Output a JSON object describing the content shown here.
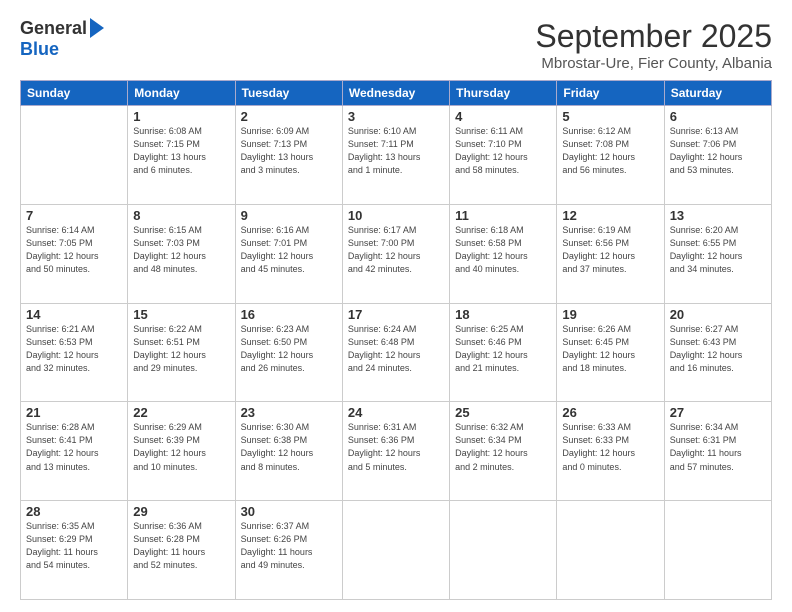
{
  "logo": {
    "general": "General",
    "blue": "Blue"
  },
  "header": {
    "month": "September 2025",
    "location": "Mbrostar-Ure, Fier County, Albania"
  },
  "days_of_week": [
    "Sunday",
    "Monday",
    "Tuesday",
    "Wednesday",
    "Thursday",
    "Friday",
    "Saturday"
  ],
  "weeks": [
    [
      {
        "day": "",
        "info": ""
      },
      {
        "day": "1",
        "info": "Sunrise: 6:08 AM\nSunset: 7:15 PM\nDaylight: 13 hours\nand 6 minutes."
      },
      {
        "day": "2",
        "info": "Sunrise: 6:09 AM\nSunset: 7:13 PM\nDaylight: 13 hours\nand 3 minutes."
      },
      {
        "day": "3",
        "info": "Sunrise: 6:10 AM\nSunset: 7:11 PM\nDaylight: 13 hours\nand 1 minute."
      },
      {
        "day": "4",
        "info": "Sunrise: 6:11 AM\nSunset: 7:10 PM\nDaylight: 12 hours\nand 58 minutes."
      },
      {
        "day": "5",
        "info": "Sunrise: 6:12 AM\nSunset: 7:08 PM\nDaylight: 12 hours\nand 56 minutes."
      },
      {
        "day": "6",
        "info": "Sunrise: 6:13 AM\nSunset: 7:06 PM\nDaylight: 12 hours\nand 53 minutes."
      }
    ],
    [
      {
        "day": "7",
        "info": "Sunrise: 6:14 AM\nSunset: 7:05 PM\nDaylight: 12 hours\nand 50 minutes."
      },
      {
        "day": "8",
        "info": "Sunrise: 6:15 AM\nSunset: 7:03 PM\nDaylight: 12 hours\nand 48 minutes."
      },
      {
        "day": "9",
        "info": "Sunrise: 6:16 AM\nSunset: 7:01 PM\nDaylight: 12 hours\nand 45 minutes."
      },
      {
        "day": "10",
        "info": "Sunrise: 6:17 AM\nSunset: 7:00 PM\nDaylight: 12 hours\nand 42 minutes."
      },
      {
        "day": "11",
        "info": "Sunrise: 6:18 AM\nSunset: 6:58 PM\nDaylight: 12 hours\nand 40 minutes."
      },
      {
        "day": "12",
        "info": "Sunrise: 6:19 AM\nSunset: 6:56 PM\nDaylight: 12 hours\nand 37 minutes."
      },
      {
        "day": "13",
        "info": "Sunrise: 6:20 AM\nSunset: 6:55 PM\nDaylight: 12 hours\nand 34 minutes."
      }
    ],
    [
      {
        "day": "14",
        "info": "Sunrise: 6:21 AM\nSunset: 6:53 PM\nDaylight: 12 hours\nand 32 minutes."
      },
      {
        "day": "15",
        "info": "Sunrise: 6:22 AM\nSunset: 6:51 PM\nDaylight: 12 hours\nand 29 minutes."
      },
      {
        "day": "16",
        "info": "Sunrise: 6:23 AM\nSunset: 6:50 PM\nDaylight: 12 hours\nand 26 minutes."
      },
      {
        "day": "17",
        "info": "Sunrise: 6:24 AM\nSunset: 6:48 PM\nDaylight: 12 hours\nand 24 minutes."
      },
      {
        "day": "18",
        "info": "Sunrise: 6:25 AM\nSunset: 6:46 PM\nDaylight: 12 hours\nand 21 minutes."
      },
      {
        "day": "19",
        "info": "Sunrise: 6:26 AM\nSunset: 6:45 PM\nDaylight: 12 hours\nand 18 minutes."
      },
      {
        "day": "20",
        "info": "Sunrise: 6:27 AM\nSunset: 6:43 PM\nDaylight: 12 hours\nand 16 minutes."
      }
    ],
    [
      {
        "day": "21",
        "info": "Sunrise: 6:28 AM\nSunset: 6:41 PM\nDaylight: 12 hours\nand 13 minutes."
      },
      {
        "day": "22",
        "info": "Sunrise: 6:29 AM\nSunset: 6:39 PM\nDaylight: 12 hours\nand 10 minutes."
      },
      {
        "day": "23",
        "info": "Sunrise: 6:30 AM\nSunset: 6:38 PM\nDaylight: 12 hours\nand 8 minutes."
      },
      {
        "day": "24",
        "info": "Sunrise: 6:31 AM\nSunset: 6:36 PM\nDaylight: 12 hours\nand 5 minutes."
      },
      {
        "day": "25",
        "info": "Sunrise: 6:32 AM\nSunset: 6:34 PM\nDaylight: 12 hours\nand 2 minutes."
      },
      {
        "day": "26",
        "info": "Sunrise: 6:33 AM\nSunset: 6:33 PM\nDaylight: 12 hours\nand 0 minutes."
      },
      {
        "day": "27",
        "info": "Sunrise: 6:34 AM\nSunset: 6:31 PM\nDaylight: 11 hours\nand 57 minutes."
      }
    ],
    [
      {
        "day": "28",
        "info": "Sunrise: 6:35 AM\nSunset: 6:29 PM\nDaylight: 11 hours\nand 54 minutes."
      },
      {
        "day": "29",
        "info": "Sunrise: 6:36 AM\nSunset: 6:28 PM\nDaylight: 11 hours\nand 52 minutes."
      },
      {
        "day": "30",
        "info": "Sunrise: 6:37 AM\nSunset: 6:26 PM\nDaylight: 11 hours\nand 49 minutes."
      },
      {
        "day": "",
        "info": ""
      },
      {
        "day": "",
        "info": ""
      },
      {
        "day": "",
        "info": ""
      },
      {
        "day": "",
        "info": ""
      }
    ]
  ]
}
